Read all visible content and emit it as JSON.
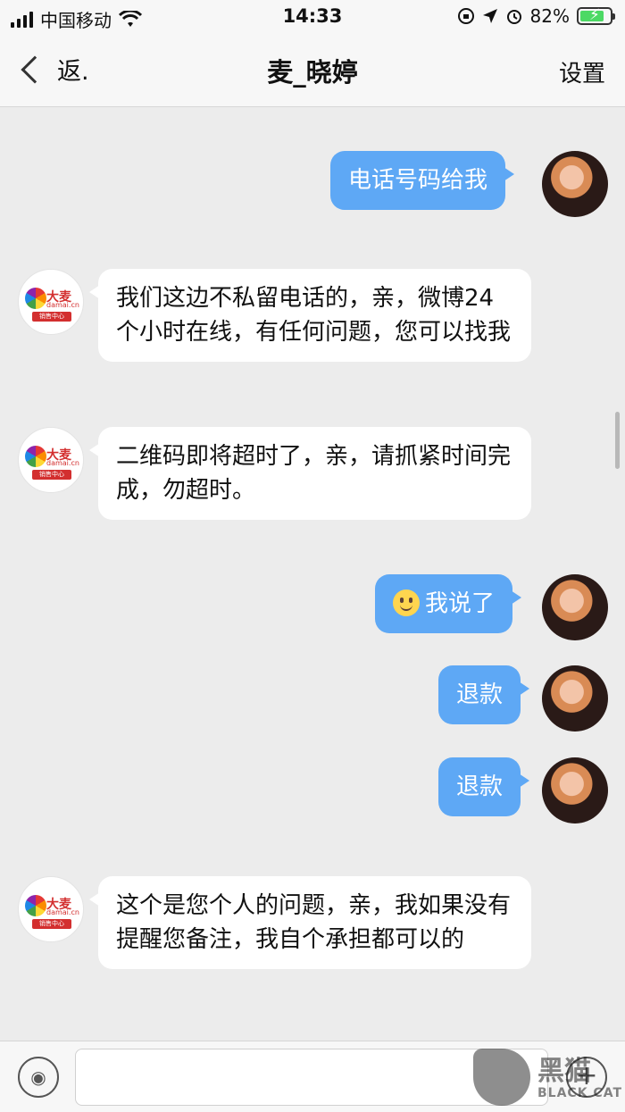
{
  "status_bar": {
    "carrier": "中国移动",
    "time": "14:33",
    "battery": "82%",
    "battery_level": 0.82
  },
  "nav": {
    "back_label": "返.",
    "title": "麦_晓婷",
    "settings_label": "设置"
  },
  "messages": [
    {
      "side": "out",
      "text": "电话号码给我"
    },
    {
      "side": "in",
      "text": "我们这边不私留电话的，亲，微博24个小时在线，有任何问题，您可以找我"
    },
    {
      "side": "in",
      "text": "二维码即将超时了，亲，请抓紧时间完成，勿超时。"
    },
    {
      "side": "out",
      "text": "我说了",
      "emoji": "smiley"
    },
    {
      "side": "out",
      "text": "退款"
    },
    {
      "side": "out",
      "text": "退款"
    },
    {
      "side": "in",
      "text": "这个是您个人的问题，亲，我如果没有提醒您备注，我自个承担都可以的"
    }
  ],
  "shop_avatar": {
    "brand": "大麦",
    "url": "damai.cn",
    "tag": "销售中心"
  },
  "input": {
    "value": "",
    "placeholder": ""
  },
  "watermark": {
    "cn": "黑猫",
    "en": "BLACK CAT"
  },
  "colors": {
    "outgoing_bubble": "#5ea8f5",
    "incoming_bubble": "#ffffff",
    "chat_background": "#ececec"
  }
}
